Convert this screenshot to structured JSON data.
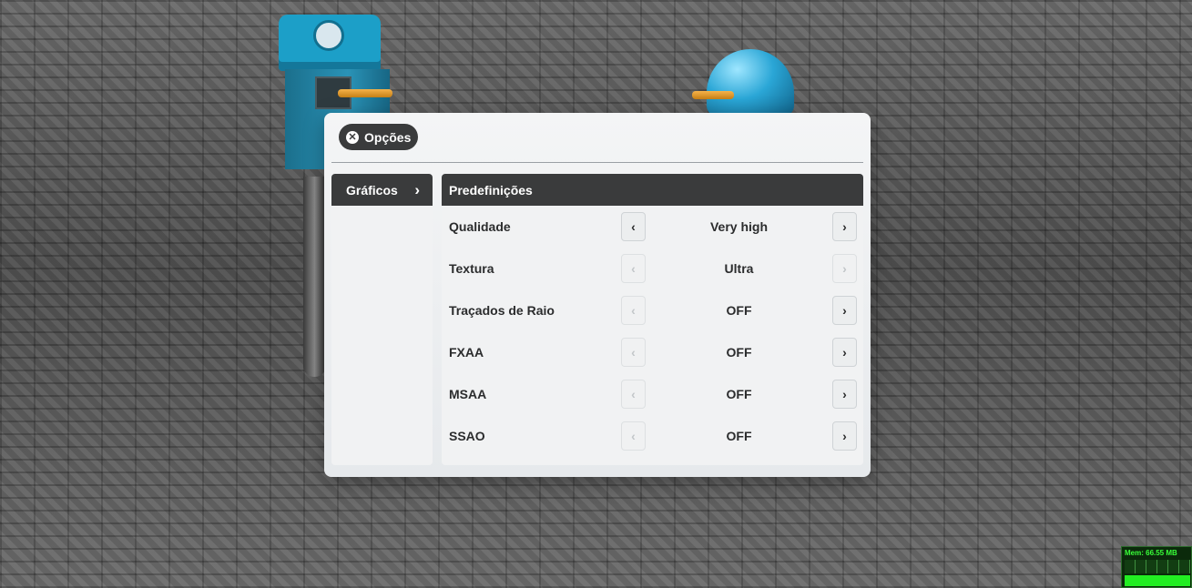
{
  "dialog": {
    "close_label": "Opções",
    "side_menu": {
      "items": [
        {
          "label": "Gráficos",
          "chevron": "›"
        }
      ]
    },
    "section_title": "Predefinições",
    "options": [
      {
        "label": "Qualidade",
        "value": "Very high",
        "left_enabled": true,
        "right_enabled": true
      },
      {
        "label": "Textura",
        "value": "Ultra",
        "left_enabled": false,
        "right_enabled": false
      },
      {
        "label": "Traçados de Raio",
        "value": "OFF",
        "left_enabled": false,
        "right_enabled": true
      },
      {
        "label": "FXAA",
        "value": "OFF",
        "left_enabled": false,
        "right_enabled": true
      },
      {
        "label": "MSAA",
        "value": "OFF",
        "left_enabled": false,
        "right_enabled": true
      },
      {
        "label": "SSAO",
        "value": "OFF",
        "left_enabled": false,
        "right_enabled": true
      }
    ],
    "arrow_left_glyph": "‹",
    "arrow_right_glyph": "›"
  },
  "mem_monitor": {
    "label": "Mem: 66.55 MB",
    "color": "#39ff39"
  },
  "icons": {
    "close": "close-icon",
    "chevron": "chevron-right-icon",
    "arrow_left": "chevron-left-icon",
    "arrow_right": "chevron-right-icon"
  }
}
